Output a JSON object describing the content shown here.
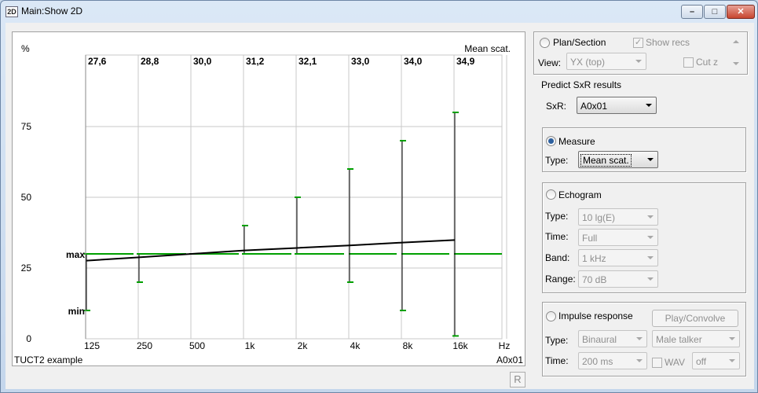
{
  "window": {
    "title": "Main:Show 2D",
    "icon_text": "2D",
    "min_icon": "minimize-icon",
    "max_icon": "maximize-icon",
    "close_icon": "close-icon"
  },
  "plot": {
    "y_unit": "%",
    "top_right_label": "Mean scat.",
    "bottom_left_label": "TUCT2 example",
    "bottom_right_label": "A0x01",
    "x_unit": "Hz",
    "max_label": "max",
    "min_label": "min",
    "r_button": "R"
  },
  "chart_data": {
    "type": "line",
    "categories": [
      "125",
      "250",
      "500",
      "1k",
      "2k",
      "4k",
      "8k",
      "16k"
    ],
    "yticks": [
      "0",
      "25",
      "50",
      "75"
    ],
    "ylim": [
      0,
      100
    ],
    "value_labels": [
      "27,6",
      "28,8",
      "30,0",
      "31,2",
      "32,1",
      "33,0",
      "34,0",
      "34,9"
    ],
    "mean": [
      27.6,
      28.8,
      30.0,
      31.2,
      32.1,
      33.0,
      34.0,
      34.9
    ],
    "max": [
      30,
      30,
      30,
      40,
      50,
      60,
      70,
      80
    ],
    "min": [
      10,
      20,
      30,
      30,
      30,
      20,
      10,
      1
    ],
    "reference": [
      30,
      30,
      30,
      30,
      30,
      30,
      30,
      30
    ],
    "grid": true,
    "colors": {
      "mean": "#000000",
      "range": "#000000",
      "tick": "#00a000",
      "reference": "#00a000",
      "grid": "#c8c8c8"
    }
  },
  "panel": {
    "plan_section": "Plan/Section",
    "show_recs": "Show recs",
    "view_label": "View:",
    "view_value": "YX (top)",
    "cut_z": "Cut z",
    "predict_title": "Predict SxR results",
    "sxr_label": "SxR:",
    "sxr_value": "A0x01",
    "measure": {
      "radio": "Measure",
      "type_label": "Type:",
      "type_value": "Mean scat."
    },
    "echogram": {
      "radio": "Echogram",
      "type_label": "Type:",
      "type_value": "10 lg(E)",
      "time_label": "Time:",
      "time_value": "Full",
      "band_label": "Band:",
      "band_value": "1 kHz",
      "range_label": "Range:",
      "range_value": "70 dB"
    },
    "impulse": {
      "radio": "Impulse response",
      "play_button": "Play/Convolve",
      "type_label": "Type:",
      "type_value": "Binaural",
      "talker_value": "Male talker",
      "time_label": "Time:",
      "time_value": "200 ms",
      "wav_label": "WAV",
      "wav_value": "off"
    },
    "scroll_up_icon": "scroll-up-icon",
    "scroll_down_icon": "scroll-down-icon"
  }
}
